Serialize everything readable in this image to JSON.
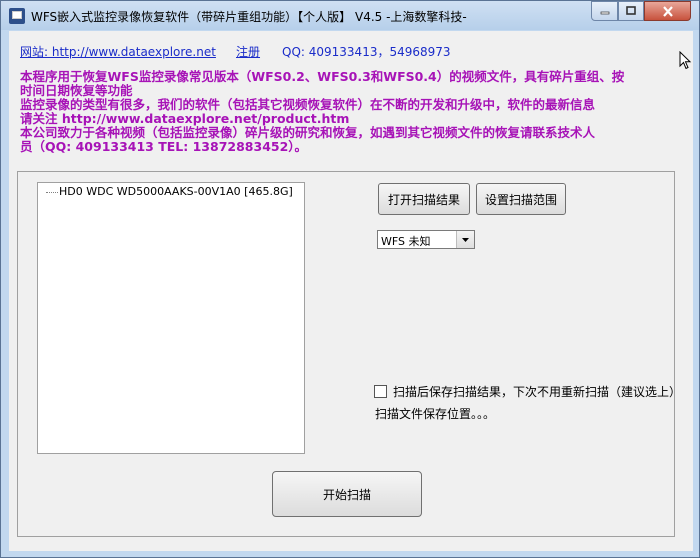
{
  "window": {
    "title": "WFS嵌入式监控录像恢复软件（带碎片重组功能）【个人版】 V4.5 -上海数擎科技-",
    "controls": [
      "minimize",
      "maximize",
      "close"
    ]
  },
  "header": {
    "website_link": "网站: http://www.dataexplore.net",
    "register_link": "注册",
    "qq_text": "QQ: 409133413，54968973"
  },
  "description": {
    "lines": [
      "本程序用于恢复WFS监控录像常见版本（WFS0.2、WFS0.3和WFS0.4）的视频文件，具有碎片重组、按",
      "时间日期恢复等功能",
      "监控录像的类型有很多，我们的软件（包括其它视频恢复软件）在不断的开发和升级中，软件的最新信息",
      "请关注 http://www.dataexplore.net/product.htm",
      "本公司致力于各种视频（包括监控录像）碎片级的研究和恢复，如遇到其它视频文件的恢复请联系技术人",
      "员（QQ: 409133413 TEL: 13872883452）。"
    ]
  },
  "disk_tree": {
    "items": [
      {
        "label": "HD0  WDC WD5000AAKS-00V1A0  [465.8G]"
      }
    ]
  },
  "buttons": {
    "open_scan_result": "打开扫描结果",
    "set_scan_range": "设置扫描范围",
    "start_scan": "开始扫描"
  },
  "fs_select": {
    "selected": "WFS 未知"
  },
  "options": {
    "save_scan_checkbox_label": "扫描后保存扫描结果，下次不用重新扫描（建议选上）",
    "save_scan_checked": false,
    "save_path_label": "扫描文件保存位置。。。"
  },
  "colors": {
    "description_text": "#a713b7",
    "link": "#1a2cc9",
    "window_frame": "#c2d8ef",
    "client_bg": "#f0f0f0"
  }
}
